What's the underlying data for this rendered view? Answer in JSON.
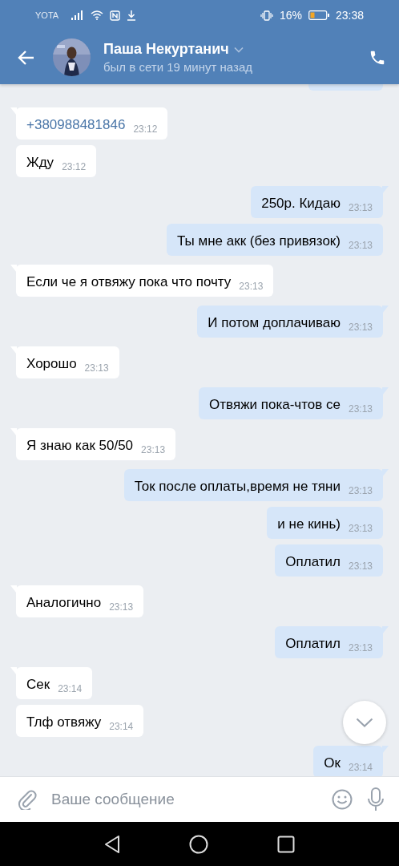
{
  "status_bar": {
    "carrier": "YOTA",
    "battery": "16%",
    "time": "23:38"
  },
  "header": {
    "name": "Паша Некуртанич",
    "status": "был в сети 19 минут назад"
  },
  "messages": [
    {
      "kind": "outgoing",
      "cut_off": true
    },
    {
      "kind": "incoming",
      "text": "+380988481846",
      "time": "23:12",
      "link": true
    },
    {
      "kind": "incoming",
      "text": "Жду",
      "time": "23:12"
    },
    {
      "kind": "outgoing",
      "text": "250р. Кидаю",
      "time": "23:13"
    },
    {
      "kind": "outgoing",
      "text": "Ты мне акк (без привязок)",
      "time": "23:13"
    },
    {
      "kind": "incoming",
      "text": "Если че я отвяжу пока что почту",
      "time": "23:13"
    },
    {
      "kind": "outgoing",
      "text": "И потом доплачиваю",
      "time": "23:13"
    },
    {
      "kind": "incoming",
      "text": "Хорошо",
      "time": "23:13"
    },
    {
      "kind": "outgoing",
      "text": "Отвяжи пока-чтов се",
      "time": "23:13"
    },
    {
      "kind": "incoming",
      "text": "Я знаю как 50/50",
      "time": "23:13"
    },
    {
      "kind": "outgoing",
      "text": "Ток после оплаты,время не тяни",
      "time": "23:13"
    },
    {
      "kind": "outgoing",
      "text": "и не кинь)",
      "time": "23:13"
    },
    {
      "kind": "outgoing",
      "text": "Оплатил",
      "time": "23:13"
    },
    {
      "kind": "incoming",
      "text": "Аналогично",
      "time": "23:13"
    },
    {
      "kind": "outgoing",
      "text": "Оплатил",
      "time": "23:13"
    },
    {
      "kind": "incoming",
      "text": "Сек",
      "time": "23:14"
    },
    {
      "kind": "incoming",
      "text": "Тлф отвяжу",
      "time": "23:14"
    },
    {
      "kind": "outgoing",
      "text": "Ок",
      "time": "23:14"
    }
  ],
  "composer": {
    "placeholder": "Ваше сообщение"
  }
}
